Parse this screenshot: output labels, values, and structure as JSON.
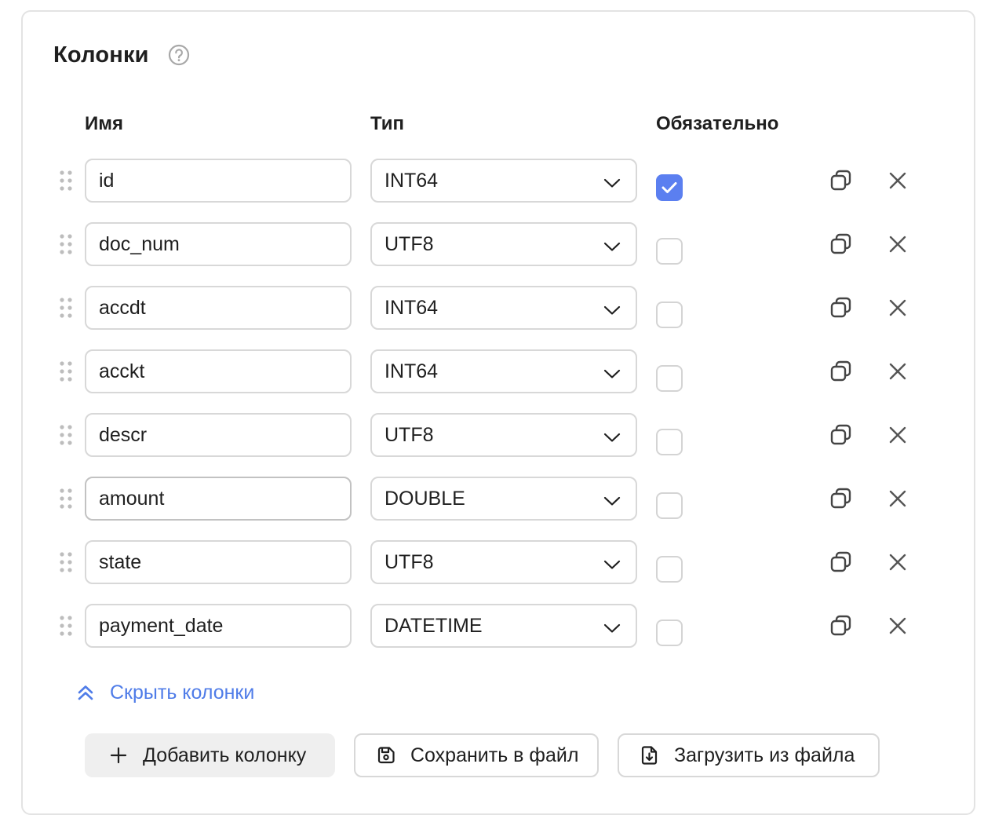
{
  "section": {
    "title": "Колонки",
    "help_icon": "question-circle-icon"
  },
  "table": {
    "headers": {
      "name": "Имя",
      "type": "Тип",
      "required": "Обязательно"
    },
    "rows": [
      {
        "name": "id",
        "type": "INT64",
        "required": true
      },
      {
        "name": "doc_num",
        "type": "UTF8",
        "required": false
      },
      {
        "name": "accdt",
        "type": "INT64",
        "required": false
      },
      {
        "name": "acckt",
        "type": "INT64",
        "required": false
      },
      {
        "name": "descr",
        "type": "UTF8",
        "required": false
      },
      {
        "name": "amount",
        "type": "DOUBLE",
        "required": false
      },
      {
        "name": "state",
        "type": "UTF8",
        "required": false
      },
      {
        "name": "payment_date",
        "type": "DATETIME",
        "required": false
      }
    ]
  },
  "actions": {
    "hide_columns": "Скрыть колонки",
    "add_column": "Добавить колонку",
    "save_to_file": "Сохранить в файл",
    "load_from_file": "Загрузить из файла"
  },
  "colors": {
    "accent": "#5b7ff0",
    "link": "#4f7ce8",
    "border": "#d8d8d8"
  }
}
